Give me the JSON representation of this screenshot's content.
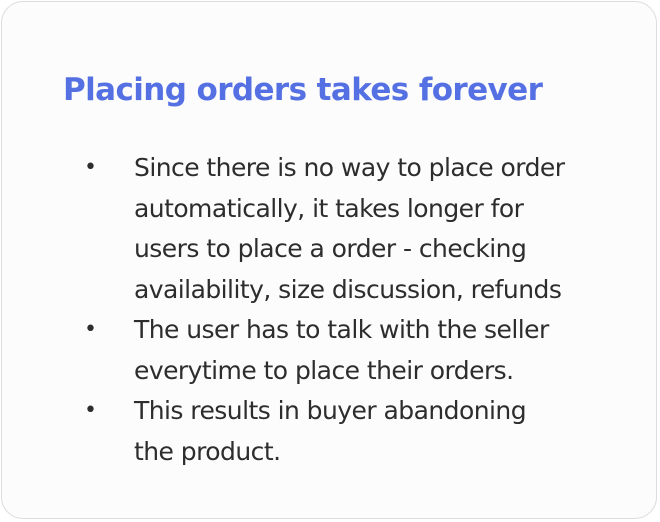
{
  "card": {
    "title": "Placing orders takes forever",
    "bullet_glyph": "•",
    "bullets": [
      {
        "lines": [
          "Since there is no way to place order",
          "automatically, it takes longer for",
          "users to place a order - checking",
          "availability, size discussion, refunds"
        ]
      },
      {
        "lines": [
          "The user has to talk with the seller",
          "everytime to place their orders."
        ]
      },
      {
        "lines": [
          "This results in buyer abandoning",
          "the product."
        ]
      }
    ]
  },
  "colors": {
    "title": "#5470e3",
    "body_text": "#2d2d2d",
    "card_border": "#dcdcdc",
    "card_background": "#fcfcfc"
  }
}
